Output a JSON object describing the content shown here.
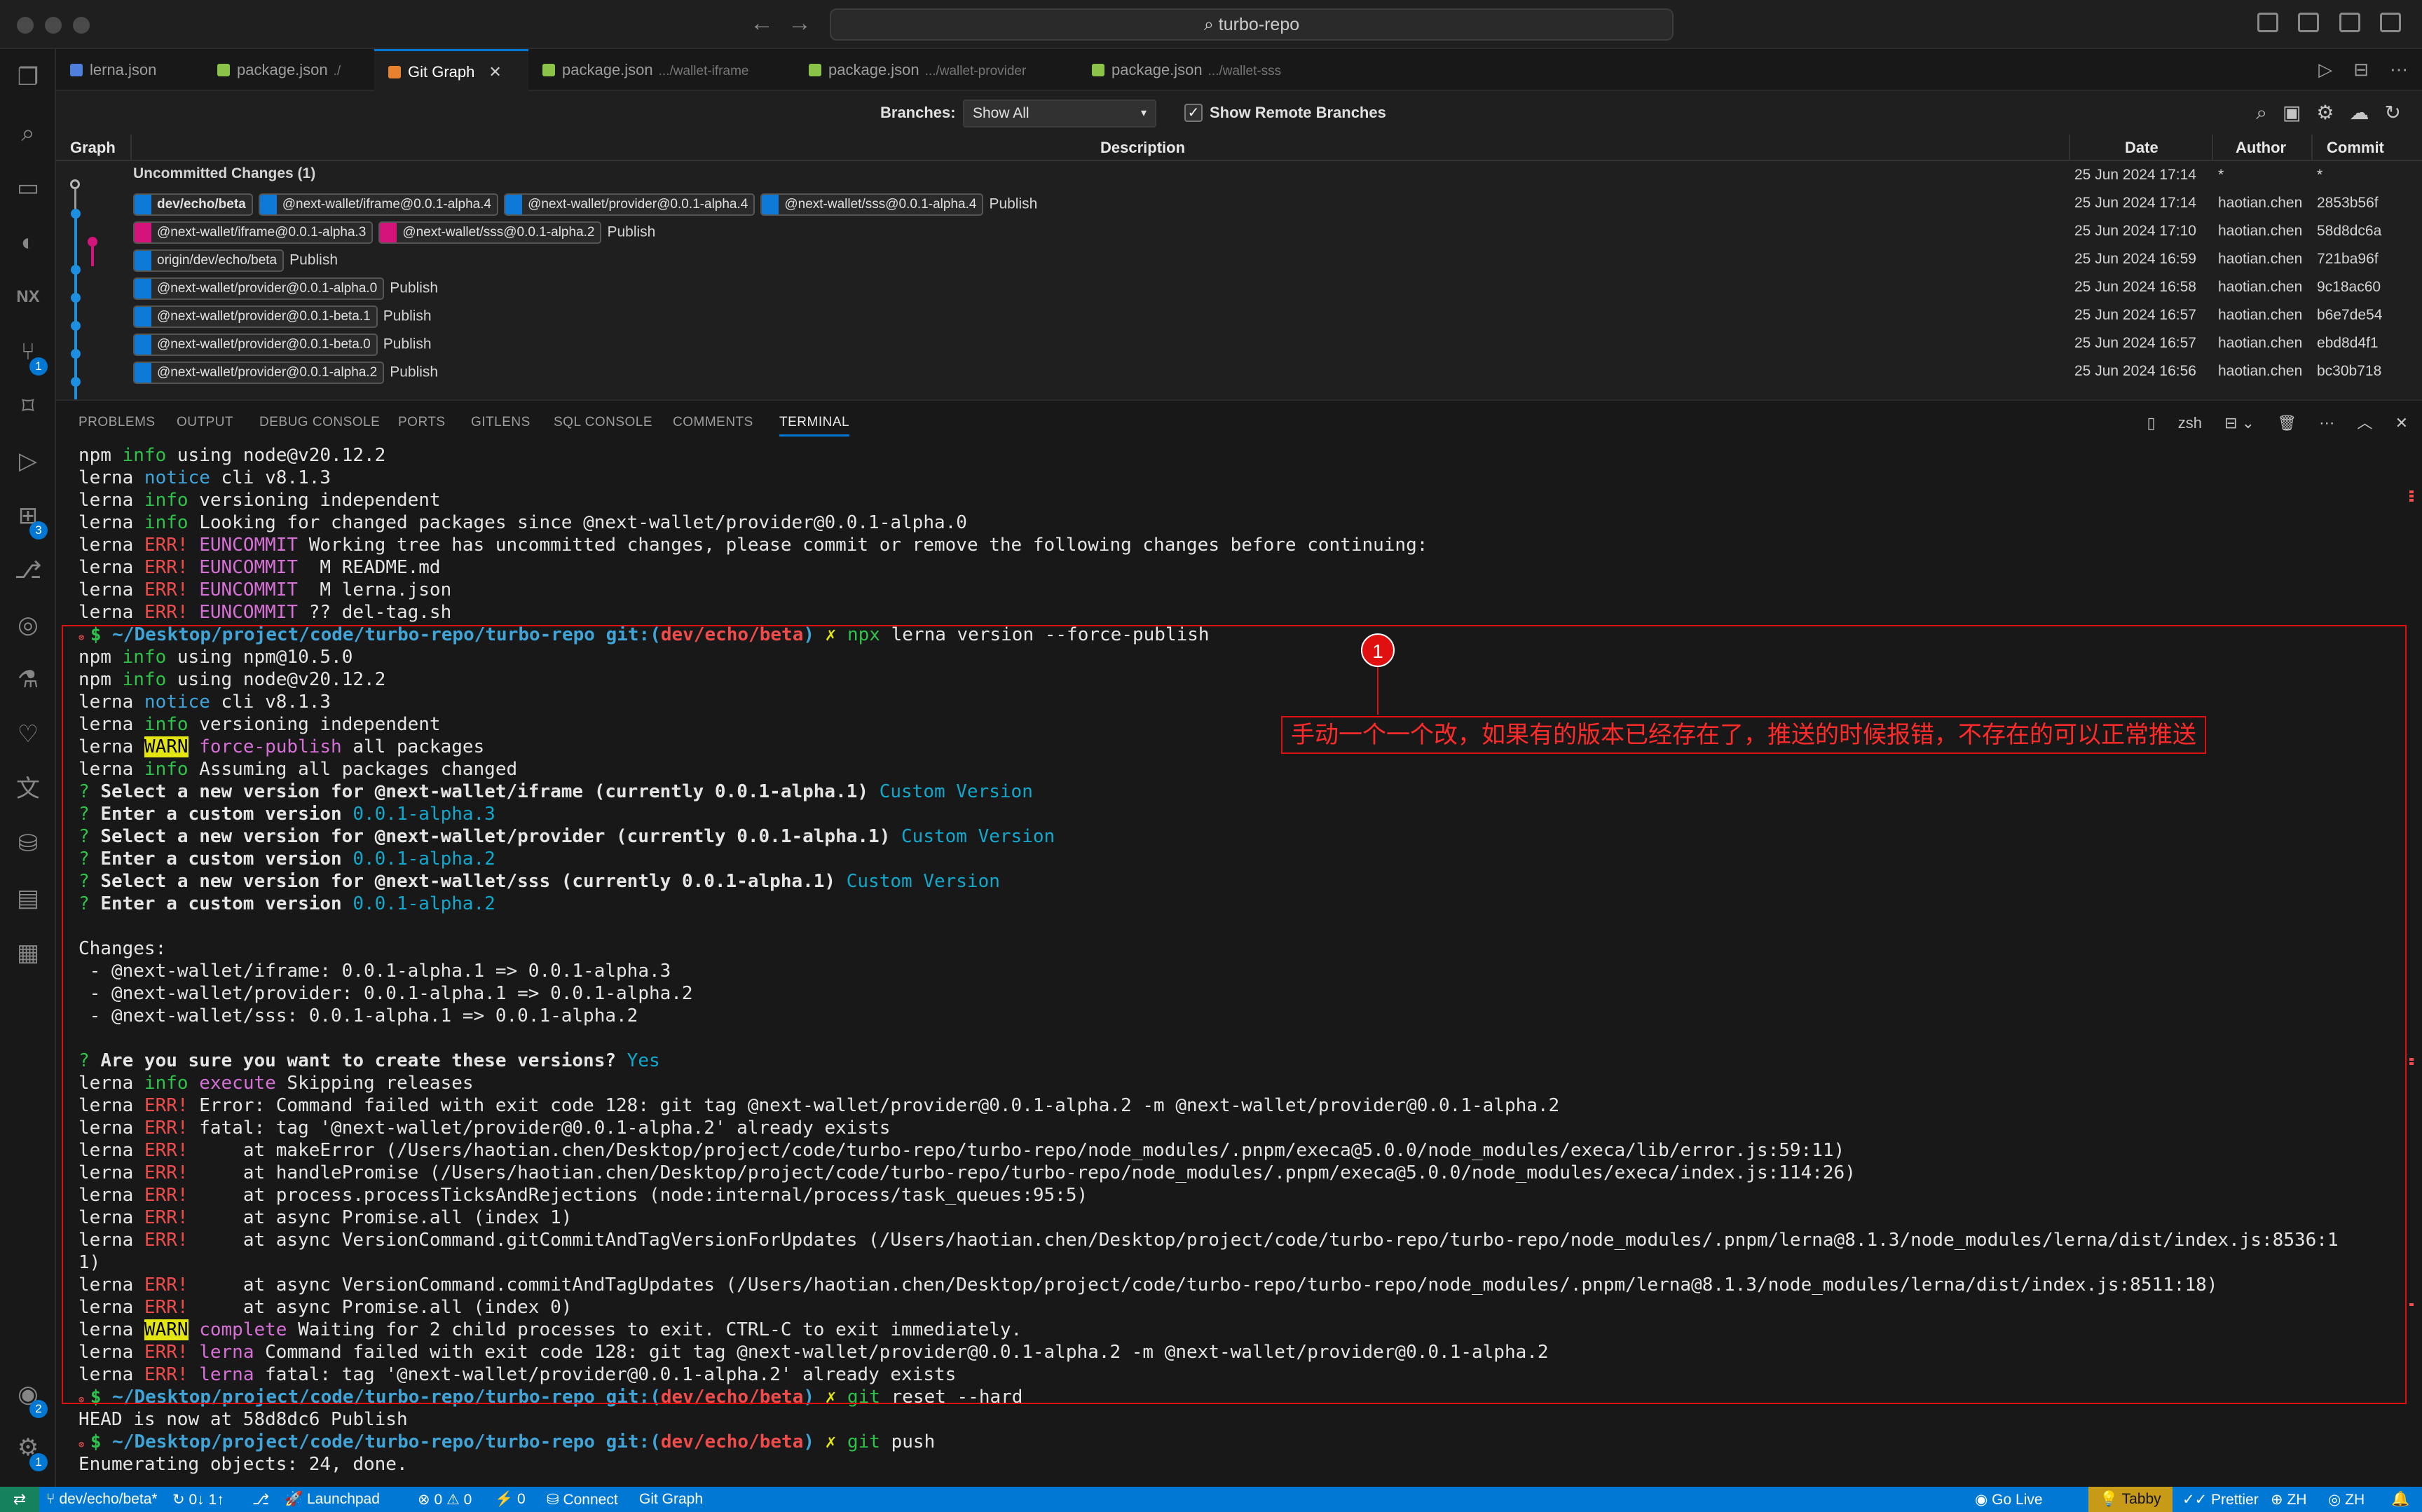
{
  "window": {
    "search": "turbo-repo"
  },
  "tabs": [
    {
      "label": "lerna.json",
      "desc": "",
      "color": "#4e7fdd",
      "active": false
    },
    {
      "label": "package.json",
      "desc": "./",
      "color": "#8bc34a",
      "active": false
    },
    {
      "label": "Git Graph",
      "desc": "",
      "color": "#e8822e",
      "active": true
    },
    {
      "label": "package.json",
      "desc": ".../wallet-iframe",
      "color": "#8bc34a",
      "active": false
    },
    {
      "label": "package.json",
      "desc": ".../wallet-provider",
      "color": "#8bc34a",
      "active": false
    },
    {
      "label": "package.json",
      "desc": ".../wallet-sss",
      "color": "#8bc34a",
      "active": false
    }
  ],
  "activity_badges": {
    "source_control": "1",
    "extensions": "3",
    "accounts": "2",
    "settings": "1"
  },
  "git_graph": {
    "branches_label": "Branches:",
    "branches_value": "Show All",
    "show_remote_label": "Show Remote Branches",
    "show_remote_checked": true,
    "columns": {
      "graph": "Graph",
      "description": "Description",
      "date": "Date",
      "author": "Author",
      "commit": "Commit"
    },
    "rows": [
      {
        "refs": [],
        "message": "Uncommitted Changes (1)",
        "bold": true,
        "date": "25 Jun 2024 17:14",
        "author": "*",
        "commit": "*"
      },
      {
        "refs": [
          {
            "label": "dev/echo/beta",
            "kind": "head",
            "color": "#0e7ad8"
          },
          {
            "label": "@next-wallet/iframe@0.0.1-alpha.4",
            "kind": "tag",
            "color": "#0e7ad8"
          },
          {
            "label": "@next-wallet/provider@0.0.1-alpha.4",
            "kind": "tag",
            "color": "#0e7ad8"
          },
          {
            "label": "@next-wallet/sss@0.0.1-alpha.4",
            "kind": "tag",
            "color": "#0e7ad8"
          }
        ],
        "message": "Publish",
        "bold": false,
        "date": "25 Jun 2024 17:14",
        "author": "haotian.chen",
        "commit": "2853b56f"
      },
      {
        "refs": [
          {
            "label": "@next-wallet/iframe@0.0.1-alpha.3",
            "kind": "tag",
            "color": "#d4147a"
          },
          {
            "label": "@next-wallet/sss@0.0.1-alpha.2",
            "kind": "tag",
            "color": "#d4147a"
          }
        ],
        "message": "Publish",
        "bold": false,
        "date": "25 Jun 2024 17:10",
        "author": "haotian.chen",
        "commit": "58d8dc6a"
      },
      {
        "refs": [
          {
            "label": "origin/dev/echo/beta",
            "kind": "branch",
            "color": "#0e7ad8"
          }
        ],
        "message": "Publish",
        "bold": false,
        "date": "25 Jun 2024 16:59",
        "author": "haotian.chen",
        "commit": "721ba96f"
      },
      {
        "refs": [
          {
            "label": "@next-wallet/provider@0.0.1-alpha.0",
            "kind": "tag",
            "color": "#0e7ad8"
          }
        ],
        "message": "Publish",
        "bold": false,
        "date": "25 Jun 2024 16:58",
        "author": "haotian.chen",
        "commit": "9c18ac60"
      },
      {
        "refs": [
          {
            "label": "@next-wallet/provider@0.0.1-beta.1",
            "kind": "tag",
            "color": "#0e7ad8"
          }
        ],
        "message": "Publish",
        "bold": false,
        "date": "25 Jun 2024 16:57",
        "author": "haotian.chen",
        "commit": "b6e7de54"
      },
      {
        "refs": [
          {
            "label": "@next-wallet/provider@0.0.1-beta.0",
            "kind": "tag",
            "color": "#0e7ad8"
          }
        ],
        "message": "Publish",
        "bold": false,
        "date": "25 Jun 2024 16:57",
        "author": "haotian.chen",
        "commit": "ebd8d4f1"
      },
      {
        "refs": [
          {
            "label": "@next-wallet/provider@0.0.1-alpha.2",
            "kind": "tag",
            "color": "#0e7ad8"
          }
        ],
        "message": "Publish",
        "bold": false,
        "date": "25 Jun 2024 16:56",
        "author": "haotian.chen",
        "commit": "bc30b718"
      }
    ]
  },
  "panel": {
    "tabs": [
      "PROBLEMS",
      "OUTPUT",
      "DEBUG CONSOLE",
      "PORTS",
      "GITLENS",
      "SQL CONSOLE",
      "COMMENTS",
      "TERMINAL"
    ],
    "active_tab": "TERMINAL",
    "shell": "zsh"
  },
  "terminal": {
    "prompt_path": "~/Desktop/project/code/turbo-repo/turbo-repo",
    "git_label": "git:(",
    "branch": "dev/echo/beta",
    "lines": [
      [
        [
          "npm ",
          ""
        ],
        [
          "info",
          "t-green"
        ],
        [
          " using node@v20.12.2",
          ""
        ]
      ],
      [
        [
          "lerna ",
          ""
        ],
        [
          "notice",
          "t-blue"
        ],
        [
          " cli v8.1.3",
          ""
        ]
      ],
      [
        [
          "lerna ",
          ""
        ],
        [
          "info",
          "t-green"
        ],
        [
          " versioning independent",
          ""
        ]
      ],
      [
        [
          "lerna ",
          ""
        ],
        [
          "info",
          "t-green"
        ],
        [
          " Looking for changed packages since @next-wallet/provider@0.0.1-alpha.0",
          ""
        ]
      ],
      [
        [
          "lerna ",
          ""
        ],
        [
          "ERR!",
          "t-red"
        ],
        [
          " ",
          ""
        ],
        [
          "EUNCOMMIT",
          "t-magenta"
        ],
        [
          " Working tree has uncommitted changes, please commit or remove the following changes before continuing:",
          ""
        ]
      ],
      [
        [
          "lerna ",
          ""
        ],
        [
          "ERR!",
          "t-red"
        ],
        [
          " ",
          ""
        ],
        [
          "EUNCOMMIT",
          "t-magenta"
        ],
        [
          "  M README.md",
          ""
        ]
      ],
      [
        [
          "lerna ",
          ""
        ],
        [
          "ERR!",
          "t-red"
        ],
        [
          " ",
          ""
        ],
        [
          "EUNCOMMIT",
          "t-magenta"
        ],
        [
          "  M lerna.json",
          ""
        ]
      ],
      [
        [
          "lerna ",
          ""
        ],
        [
          "ERR!",
          "t-red"
        ],
        [
          " ",
          ""
        ],
        [
          "EUNCOMMIT",
          "t-magenta"
        ],
        [
          " ?? del-tag.sh",
          ""
        ]
      ],
      [
        [
          "PROMPT",
          "prompt"
        ],
        [
          "npx",
          "t-cmd-green"
        ],
        [
          " lerna version --force-publish",
          ""
        ]
      ],
      [
        [
          "npm ",
          ""
        ],
        [
          "info",
          "t-green"
        ],
        [
          " using npm@10.5.0",
          ""
        ]
      ],
      [
        [
          "npm ",
          ""
        ],
        [
          "info",
          "t-green"
        ],
        [
          " using node@v20.12.2",
          ""
        ]
      ],
      [
        [
          "lerna ",
          ""
        ],
        [
          "notice",
          "t-blue"
        ],
        [
          " cli v8.1.3",
          ""
        ]
      ],
      [
        [
          "lerna ",
          ""
        ],
        [
          "info",
          "t-green"
        ],
        [
          " versioning independent",
          ""
        ]
      ],
      [
        [
          "lerna ",
          ""
        ],
        [
          "WARN",
          "t-yellowbg"
        ],
        [
          " ",
          ""
        ],
        [
          "force-publish",
          "t-magenta"
        ],
        [
          " all packages",
          ""
        ]
      ],
      [
        [
          "lerna ",
          ""
        ],
        [
          "info",
          "t-green"
        ],
        [
          " Assuming all packages changed",
          ""
        ]
      ],
      [
        [
          "? ",
          "t-green"
        ],
        [
          "Select a new version for @next-wallet/iframe (currently 0.0.1-alpha.1)",
          "t-bold"
        ],
        [
          " Custom Version",
          "t-cyan"
        ]
      ],
      [
        [
          "? ",
          "t-green"
        ],
        [
          "Enter a custom version",
          "t-bold"
        ],
        [
          " 0.0.1-alpha.3",
          "t-cyan"
        ]
      ],
      [
        [
          "? ",
          "t-green"
        ],
        [
          "Select a new version for @next-wallet/provider (currently 0.0.1-alpha.1)",
          "t-bold"
        ],
        [
          " Custom Version",
          "t-cyan"
        ]
      ],
      [
        [
          "? ",
          "t-green"
        ],
        [
          "Enter a custom version",
          "t-bold"
        ],
        [
          " 0.0.1-alpha.2",
          "t-cyan"
        ]
      ],
      [
        [
          "? ",
          "t-green"
        ],
        [
          "Select a new version for @next-wallet/sss (currently 0.0.1-alpha.1)",
          "t-bold"
        ],
        [
          " Custom Version",
          "t-cyan"
        ]
      ],
      [
        [
          "? ",
          "t-green"
        ],
        [
          "Enter a custom version",
          "t-bold"
        ],
        [
          " 0.0.1-alpha.2",
          "t-cyan"
        ]
      ],
      [
        [
          "",
          ""
        ]
      ],
      [
        [
          "Changes:",
          ""
        ]
      ],
      [
        [
          " - @next-wallet/iframe: 0.0.1-alpha.1 => 0.0.1-alpha.3",
          ""
        ]
      ],
      [
        [
          " - @next-wallet/provider: 0.0.1-alpha.1 => 0.0.1-alpha.2",
          ""
        ]
      ],
      [
        [
          " - @next-wallet/sss: 0.0.1-alpha.1 => 0.0.1-alpha.2",
          ""
        ]
      ],
      [
        [
          "",
          ""
        ]
      ],
      [
        [
          "? ",
          "t-green"
        ],
        [
          "Are you sure you want to create these versions?",
          "t-bold"
        ],
        [
          " Yes",
          "t-cyan"
        ]
      ],
      [
        [
          "lerna ",
          ""
        ],
        [
          "info",
          "t-green"
        ],
        [
          " ",
          ""
        ],
        [
          "execute",
          "t-magenta"
        ],
        [
          " Skipping releases",
          ""
        ]
      ],
      [
        [
          "lerna ",
          ""
        ],
        [
          "ERR!",
          "t-red"
        ],
        [
          " Error: Command failed with exit code 128: git tag @next-wallet/provider@0.0.1-alpha.2 -m @next-wallet/provider@0.0.1-alpha.2",
          ""
        ]
      ],
      [
        [
          "lerna ",
          ""
        ],
        [
          "ERR!",
          "t-red"
        ],
        [
          " fatal: tag '@next-wallet/provider@0.0.1-alpha.2' already exists",
          ""
        ]
      ],
      [
        [
          "lerna ",
          ""
        ],
        [
          "ERR!",
          "t-red"
        ],
        [
          "     at makeError (/Users/haotian.chen/Desktop/project/code/turbo-repo/turbo-repo/node_modules/.pnpm/execa@5.0.0/node_modules/execa/lib/error.js:59:11)",
          ""
        ]
      ],
      [
        [
          "lerna ",
          ""
        ],
        [
          "ERR!",
          "t-red"
        ],
        [
          "     at handlePromise (/Users/haotian.chen/Desktop/project/code/turbo-repo/turbo-repo/node_modules/.pnpm/execa@5.0.0/node_modules/execa/index.js:114:26)",
          ""
        ]
      ],
      [
        [
          "lerna ",
          ""
        ],
        [
          "ERR!",
          "t-red"
        ],
        [
          "     at process.processTicksAndRejections (node:internal/process/task_queues:95:5)",
          ""
        ]
      ],
      [
        [
          "lerna ",
          ""
        ],
        [
          "ERR!",
          "t-red"
        ],
        [
          "     at async Promise.all (index 1)",
          ""
        ]
      ],
      [
        [
          "lerna ",
          ""
        ],
        [
          "ERR!",
          "t-red"
        ],
        [
          "     at async VersionCommand.gitCommitAndTagVersionForUpdates (/Users/haotian.chen/Desktop/project/code/turbo-repo/turbo-repo/node_modules/.pnpm/lerna@8.1.3/node_modules/lerna/dist/index.js:8536:1",
          ""
        ]
      ],
      [
        [
          "1)",
          ""
        ]
      ],
      [
        [
          "lerna ",
          ""
        ],
        [
          "ERR!",
          "t-red"
        ],
        [
          "     at async VersionCommand.commitAndTagUpdates (/Users/haotian.chen/Desktop/project/code/turbo-repo/turbo-repo/node_modules/.pnpm/lerna@8.1.3/node_modules/lerna/dist/index.js:8511:18)",
          ""
        ]
      ],
      [
        [
          "lerna ",
          ""
        ],
        [
          "ERR!",
          "t-red"
        ],
        [
          "     at async Promise.all (index 0)",
          ""
        ]
      ],
      [
        [
          "lerna ",
          ""
        ],
        [
          "WARN",
          "t-yellowbg"
        ],
        [
          " ",
          ""
        ],
        [
          "complete",
          "t-magenta"
        ],
        [
          " Waiting for 2 child processes to exit. CTRL-C to exit immediately.",
          ""
        ]
      ],
      [
        [
          "lerna ",
          ""
        ],
        [
          "ERR!",
          "t-red"
        ],
        [
          " ",
          ""
        ],
        [
          "lerna",
          "t-magenta"
        ],
        [
          " Command failed with exit code 128: git tag @next-wallet/provider@0.0.1-alpha.2 -m @next-wallet/provider@0.0.1-alpha.2",
          ""
        ]
      ],
      [
        [
          "lerna ",
          ""
        ],
        [
          "ERR!",
          "t-red"
        ],
        [
          " ",
          ""
        ],
        [
          "lerna",
          "t-magenta"
        ],
        [
          " fatal: tag '@next-wallet/provider@0.0.1-alpha.2' already exists",
          ""
        ]
      ],
      [
        [
          "PROMPT",
          "prompt"
        ],
        [
          "git",
          "t-cmd-green"
        ],
        [
          " reset --hard",
          ""
        ]
      ],
      [
        [
          "HEAD is now at 58d8dc6 Publish",
          ""
        ]
      ],
      [
        [
          "PROMPT",
          "prompt"
        ],
        [
          "git",
          "t-cmd-green"
        ],
        [
          " push",
          ""
        ]
      ],
      [
        [
          "Enumerating objects: 24, done.",
          ""
        ]
      ]
    ]
  },
  "annotation": {
    "number": "1",
    "text": "手动一个一个改，如果有的版本已经存在了，推送的时候报错，不存在的可以正常推送",
    "color": "#e01010"
  },
  "statusbar": {
    "branch": "dev/echo/beta*",
    "sync": "0↓ 1↑",
    "launchpad": "Launchpad",
    "problems": "0 ⚠ 0",
    "ports": "0",
    "connect": "Connect",
    "git_graph": "Git Graph",
    "go_live": "Go Live",
    "tabby": "Tabby",
    "prettier": "Prettier",
    "lang": "ZH",
    "lang2": "ZH"
  }
}
